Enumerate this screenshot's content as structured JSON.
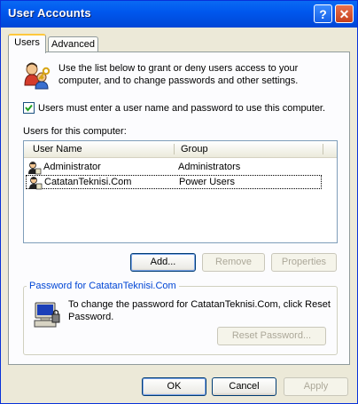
{
  "window": {
    "title": "User Accounts",
    "help_glyph": "?",
    "close_glyph": "✕"
  },
  "tabs": [
    {
      "label": "Users",
      "active": true
    },
    {
      "label": "Advanced",
      "active": false
    }
  ],
  "intro": {
    "line1": "Use the list below to grant or deny users access to your",
    "line2": "computer, and to change passwords and other settings."
  },
  "require_login": {
    "label": "Users must enter a user name and password to use this computer.",
    "checked": true
  },
  "users_list": {
    "caption": "Users for this computer:",
    "columns": [
      "User Name",
      "Group"
    ],
    "rows": [
      {
        "name": "Administrator",
        "group": "Administrators"
      },
      {
        "name": "CatatanTeknisi.Com",
        "group": "Power Users"
      }
    ]
  },
  "list_buttons": {
    "add": "Add...",
    "remove": "Remove",
    "properties": "Properties"
  },
  "password_group": {
    "title": "Password for CatatanTeknisi.Com",
    "text_line1": "To change the password for CatatanTeknisi.Com, click Reset",
    "text_line2": "Password.",
    "reset_button": "Reset Password..."
  },
  "dialog_buttons": {
    "ok": "OK",
    "cancel": "Cancel",
    "apply": "Apply"
  },
  "colors": {
    "titlebar": "#0058ee",
    "face": "#ece9d8",
    "group_title": "#0046d5"
  }
}
